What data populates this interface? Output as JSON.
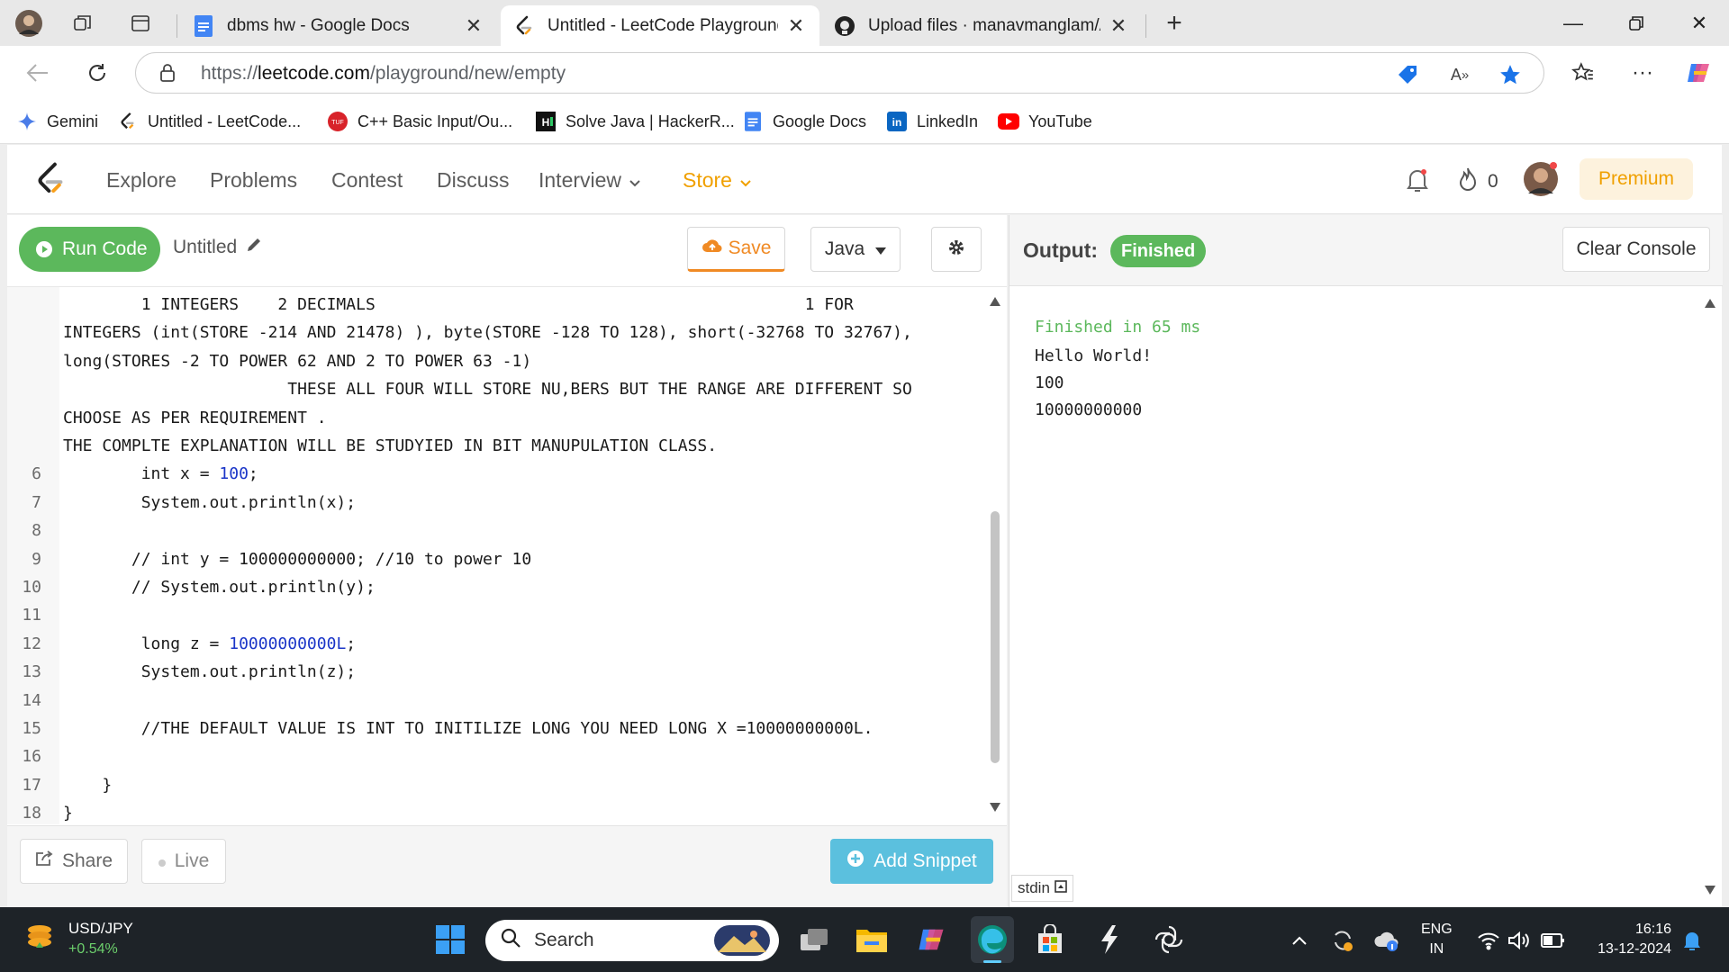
{
  "browser": {
    "tabs": [
      {
        "title": "dbms hw - Google Docs",
        "icon": "google-docs-icon"
      },
      {
        "title": "Untitled - LeetCode Playground",
        "icon": "leetcode-icon",
        "active": true
      },
      {
        "title": "Upload files · manavmanglam/AL",
        "icon": "github-icon"
      }
    ],
    "url_prefix": "https://",
    "url_domain": "leetcode.com",
    "url_path": "/playground/new/empty"
  },
  "favorites": [
    {
      "label": "Gemini",
      "icon": "gemini-icon"
    },
    {
      "label": "Untitled - LeetCode...",
      "icon": "leetcode-icon"
    },
    {
      "label": "C++ Basic Input/Ou...",
      "icon": "tuf-icon"
    },
    {
      "label": "Solve Java | HackerR...",
      "icon": "hackerrank-icon"
    },
    {
      "label": "Google Docs",
      "icon": "google-docs-icon"
    },
    {
      "label": "LinkedIn",
      "icon": "linkedin-icon"
    },
    {
      "label": "YouTube",
      "icon": "youtube-icon"
    }
  ],
  "leetcode_nav": {
    "links": [
      "Explore",
      "Problems",
      "Contest",
      "Discuss",
      "Interview",
      "Store"
    ],
    "streak_count": "0",
    "premium_label": "Premium"
  },
  "editor": {
    "run_label": "Run Code",
    "file_title": "Untitled",
    "save_label": "Save",
    "language": "Java",
    "lines": [
      {
        "n": "",
        "text": "        1 INTEGERS    2 DECIMALS                                            1 FOR",
        "cls": "cm"
      },
      {
        "n": "",
        "text": "INTEGERS (int(STORE -214 AND 21478) ), byte(STORE -128 TO 128), short(-32768 TO 32767),",
        "cls": "cm"
      },
      {
        "n": "",
        "text": "long(STORES -2 TO POWER 62 AND 2 TO POWER 63 -1)",
        "cls": "cm"
      },
      {
        "n": "",
        "text": "                       THESE ALL FOUR WILL STORE NU,BERS BUT THE RANGE ARE DIFFERENT SO",
        "cls": "cm"
      },
      {
        "n": "",
        "text": "CHOOSE AS PER REQUIREMENT .",
        "cls": "cm"
      },
      {
        "n": "",
        "text": "THE COMPLTE EXPLANATION WILL BE STUDYIED IN BIT MANUPULATION CLASS.",
        "cls": "cm"
      },
      {
        "n": "6",
        "pre": "        int x = ",
        "num": "100",
        "post": ";",
        "cls": "code"
      },
      {
        "n": "7",
        "text": "        System.out.println(x);",
        "cls": "code"
      },
      {
        "n": "8",
        "text": "",
        "cls": "code"
      },
      {
        "n": "9",
        "text": "       // int y = 100000000000; //10 to power 10",
        "cls": "cm"
      },
      {
        "n": "10",
        "text": "       // System.out.println(y);",
        "cls": "cm"
      },
      {
        "n": "11",
        "text": "",
        "cls": "code"
      },
      {
        "n": "12",
        "pre": "        long z = ",
        "num": "10000000000L",
        "post": ";",
        "cls": "code"
      },
      {
        "n": "13",
        "text": "        System.out.println(z);",
        "cls": "code"
      },
      {
        "n": "14",
        "text": "",
        "cls": "code"
      },
      {
        "n": "15",
        "text": "        //THE DEFAULT VALUE IS INT TO INITILIZE LONG YOU NEED LONG X =10000000000L.",
        "cls": "cm"
      },
      {
        "n": "16",
        "text": "",
        "cls": "code"
      },
      {
        "n": "17",
        "text": "    }",
        "cls": "code"
      },
      {
        "n": "18",
        "text": "}",
        "cls": "code"
      }
    ],
    "share_label": "Share",
    "live_label": "Live",
    "add_snippet_label": "Add Snippet"
  },
  "output": {
    "label": "Output:",
    "status": "Finished",
    "clear_label": "Clear Console",
    "meta": "Finished in 65 ms",
    "results": [
      "Hello World!",
      "100",
      "10000000000"
    ],
    "stdin_label": "stdin"
  },
  "taskbar": {
    "stock_symbol": "USD/JPY",
    "stock_change": "+0.54%",
    "search_placeholder": "Search",
    "lang_line1": "ENG",
    "lang_line2": "IN",
    "time": "16:16",
    "date": "13-12-2024"
  },
  "colors": {
    "run_green": "#5cb85c",
    "comment_blue": "#2f7fd8",
    "number_blue": "#1a35c8",
    "store_orange": "#f0a000",
    "save_orange": "#f08a24",
    "snippet_blue": "#5bc0de"
  }
}
